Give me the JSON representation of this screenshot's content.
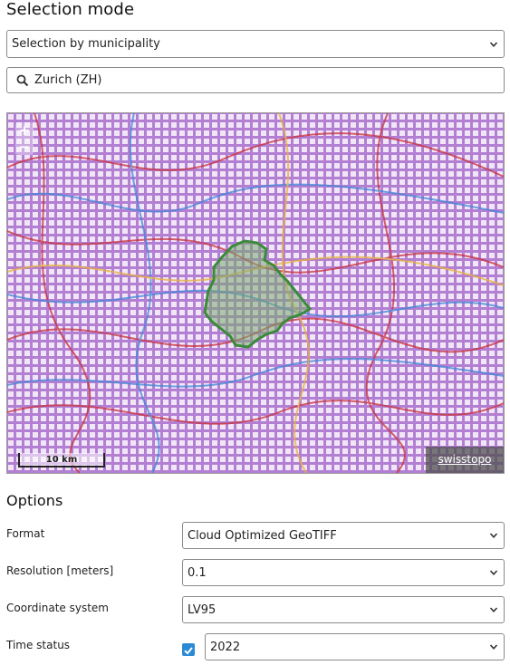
{
  "selection": {
    "title": "Selection mode",
    "mode_value": "Selection by municipality",
    "search_value": "Zurich (ZH)"
  },
  "map": {
    "zoom_in": "+",
    "zoom_out": "−",
    "scale_label": "10 km",
    "attribution": "swisstopo"
  },
  "options": {
    "title": "Options",
    "format_label": "Format",
    "format_value": "Cloud Optimized GeoTIFF",
    "resolution_label": "Resolution [meters]",
    "resolution_value": "0.1",
    "crs_label": "Coordinate system",
    "crs_value": "LV95",
    "time_label": "Time status",
    "time_checked": true,
    "time_value": "2022"
  },
  "icons": {
    "search": "search-icon",
    "chevron": "chevron-down-icon",
    "check": "checkmark-icon"
  },
  "colors": {
    "map_purple": "#b889d6",
    "selection_green": "#3a8a3a",
    "checkbox_blue": "#2b8ad6"
  }
}
